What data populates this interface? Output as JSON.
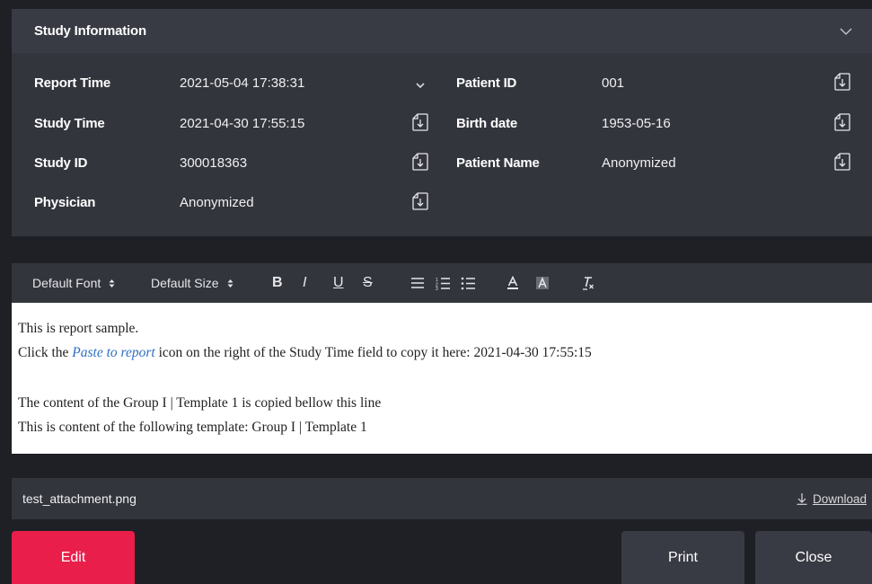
{
  "study": {
    "title": "Study Information",
    "fields": {
      "report_time": {
        "label": "Report Time",
        "value": "2021-05-04 17:38:31"
      },
      "study_time": {
        "label": "Study Time",
        "value": "2021-04-30 17:55:15"
      },
      "study_id": {
        "label": "Study ID",
        "value": "300018363"
      },
      "physician": {
        "label": "Physician",
        "value": "Anonymized"
      },
      "patient_id": {
        "label": "Patient ID",
        "value": "001"
      },
      "birth_date": {
        "label": "Birth date",
        "value": "1953-05-16"
      },
      "patient_name": {
        "label": "Patient Name",
        "value": "Anonymized"
      }
    }
  },
  "toolbar": {
    "font": "Default Font",
    "size": "Default Size",
    "bold": "B",
    "italic": "I",
    "underline": "U",
    "strike": "S",
    "icons": [
      "align-icon",
      "ordered-list-icon",
      "bullet-list-icon",
      "font-color-icon",
      "background-color-icon",
      "clear-format-icon"
    ]
  },
  "editor": {
    "line1": "This is report sample.",
    "line2_pre": "Click the ",
    "line2_link": "Paste to report",
    "line2_post": " icon on the right of the Study Time field to copy it here: 2021-04-30 17:55:15",
    "line3": "The content of the Group I | Template 1 is copied bellow this line",
    "line4": "This is content of the following template: Group I | Template 1",
    "link_color": "#2f6fc1"
  },
  "attachment": {
    "filename": "test_attachment.png",
    "download_label": "Download"
  },
  "buttons": {
    "edit": "Edit",
    "print": "Print",
    "close": "Close"
  },
  "colors": {
    "edit_button": "#e91e4b",
    "panel": "#33353d",
    "header": "#393b44",
    "background": "#1f2025"
  }
}
